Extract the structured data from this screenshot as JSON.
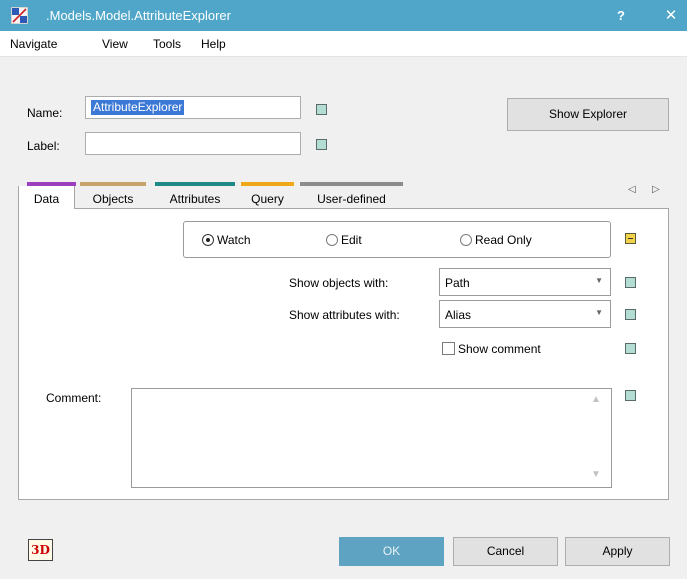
{
  "window": {
    "title": ".Models.Model.AttributeExplorer",
    "help_label": "?",
    "close_label": "✕"
  },
  "menu": [
    "Navigate",
    "View",
    "Tools",
    "Help"
  ],
  "fields": {
    "name_label": "Name:",
    "name_value": "AttributeExplorer",
    "label_label": "Label:",
    "label_value": ""
  },
  "show_explorer_label": "Show Explorer",
  "tabs": [
    {
      "label": "Data",
      "color": "#9b3fbf",
      "active": true
    },
    {
      "label": "Objects",
      "color": "#c8a46a"
    },
    {
      "label": "Attributes",
      "color": "#1f8a84"
    },
    {
      "label": "Query",
      "color": "#f0a818"
    },
    {
      "label": "User-defined",
      "color": "#8c8c8c"
    }
  ],
  "tab_nav": {
    "prev": "◁",
    "next": "▷"
  },
  "mode": {
    "options": [
      "Watch",
      "Edit",
      "Read Only"
    ],
    "selected": "Watch"
  },
  "show_objects": {
    "label": "Show objects with:",
    "value": "Path"
  },
  "show_attributes": {
    "label": "Show attributes with:",
    "value": "Alias"
  },
  "show_comment": {
    "label": "Show comment",
    "checked": false
  },
  "comment": {
    "label": "Comment:",
    "value": ""
  },
  "buttons": {
    "ok": "OK",
    "cancel": "Cancel",
    "apply": "Apply"
  },
  "icon_3d_label": "3D",
  "colors": {
    "title_bar": "#4fa6c8",
    "indicator": "#b3dcd3",
    "indicator_alt": "#f2d24a"
  }
}
